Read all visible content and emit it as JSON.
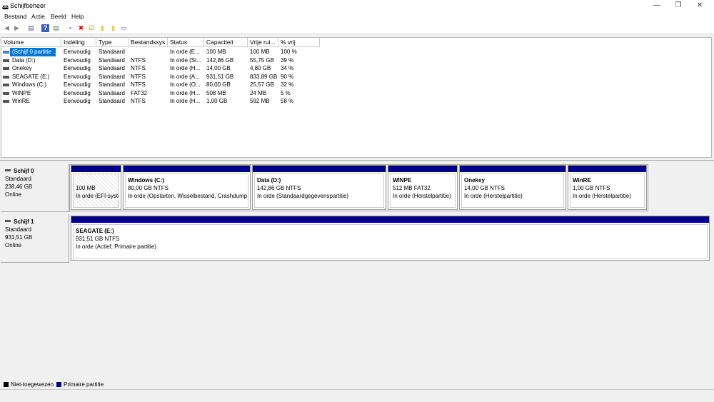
{
  "window": {
    "title": "Schijfbeheer",
    "minimize": "—",
    "restore": "❐",
    "close": "✕"
  },
  "menu": [
    "Bestand",
    "Actie",
    "Beeld",
    "Help"
  ],
  "toolbar": [
    {
      "icon": "back-arrow-icon",
      "glyph": "◀",
      "color": "#888"
    },
    {
      "icon": "forward-arrow-icon",
      "glyph": "▶",
      "color": "#888"
    },
    {
      "icon": "console-tree-icon",
      "glyph": "▤",
      "color": "#557"
    },
    {
      "icon": "help-icon",
      "glyph": "?",
      "color": "#fff"
    },
    {
      "icon": "properties-pane-icon",
      "glyph": "▤",
      "color": "#575"
    },
    {
      "icon": "connect-drive-icon",
      "glyph": "⌁",
      "color": "#466"
    },
    {
      "icon": "delete-icon",
      "glyph": "✖",
      "color": "#e00"
    },
    {
      "icon": "check-icon",
      "glyph": "☑",
      "color": "#c80"
    },
    {
      "icon": "folder-up-icon",
      "glyph": "▮",
      "color": "#f4c842"
    },
    {
      "icon": "folder-search-icon",
      "glyph": "▮",
      "color": "#f4c842"
    },
    {
      "icon": "view-icon",
      "glyph": "▭",
      "color": "#579"
    }
  ],
  "table": {
    "columns": [
      "Volume",
      "Indeling",
      "Type",
      "Bestandssys...",
      "Status",
      "Capaciteit",
      "Vrije rui...",
      "% vrij"
    ],
    "rows": [
      [
        "(Schijf 0 partitie ...",
        "Eenvoudig",
        "Standaard",
        "",
        "In orde (E...",
        "100 MB",
        "100 MB",
        "100 %"
      ],
      [
        "Data (D:)",
        "Eenvoudig",
        "Standaard",
        "NTFS",
        "In orde (St...",
        "142,86 GB",
        "55,75 GB",
        "39 %"
      ],
      [
        "Onekey",
        "Eenvoudig",
        "Standaard",
        "NTFS",
        "In orde (H...",
        "14,00 GB",
        "4,80 GB",
        "34 %"
      ],
      [
        "SEAGATE (E:)",
        "Eenvoudig",
        "Standaard",
        "NTFS",
        "In orde (A...",
        "931,51 GB",
        "833,89 GB",
        "90 %"
      ],
      [
        "Windows (C:)",
        "Eenvoudig",
        "Standaard",
        "NTFS",
        "In orde (O...",
        "80,00 GB",
        "25,57 GB",
        "32 %"
      ],
      [
        "WINPE",
        "Eenvoudig",
        "Standaard",
        "FAT32",
        "In orde (H...",
        "508 MB",
        "24 MB",
        "5 %"
      ],
      [
        "WinRE",
        "Eenvoudig",
        "Standaard",
        "NTFS",
        "In orde (H...",
        "1,00 GB",
        "592 MB",
        "58 %"
      ]
    ],
    "selected_row": 0
  },
  "disks": [
    {
      "name": "Schijf 0",
      "type": "Standaard",
      "size": "238,46 GB",
      "status": "Online",
      "partitions": [
        {
          "name": "",
          "size": "100 MB",
          "status": "In orde (EFI-systee"
        },
        {
          "name": "Windows  (C:)",
          "size": "80,00 GB NTFS",
          "status": "In orde (Opstarten, Wisselbestand, Crashdump, St"
        },
        {
          "name": "Data  (D:)",
          "size": "142,86 GB NTFS",
          "status": "In orde (Standaardgegevenspartitie)"
        },
        {
          "name": "WINPE",
          "size": "512 MB FAT32",
          "status": "In orde (Herstelpartitie)"
        },
        {
          "name": "Onekey",
          "size": "14,00 GB NTFS",
          "status": "In orde (Herstelpartitie)"
        },
        {
          "name": "WinRE",
          "size": "1,00 GB NTFS",
          "status": "In orde (Herstelpartitie)"
        }
      ]
    },
    {
      "name": "Schijf 1",
      "type": "Standaard",
      "size": "931,51 GB",
      "status": "Online",
      "partitions": [
        {
          "name": "SEAGATE  (E:)",
          "size": "931,51 GB NTFS",
          "status": "In orde (Actief, Primaire partitie)"
        }
      ]
    }
  ],
  "legend": [
    {
      "label": "Niet-toegewezen",
      "color": "#000000"
    },
    {
      "label": "Primaire partitie",
      "color": "#00008b"
    }
  ]
}
